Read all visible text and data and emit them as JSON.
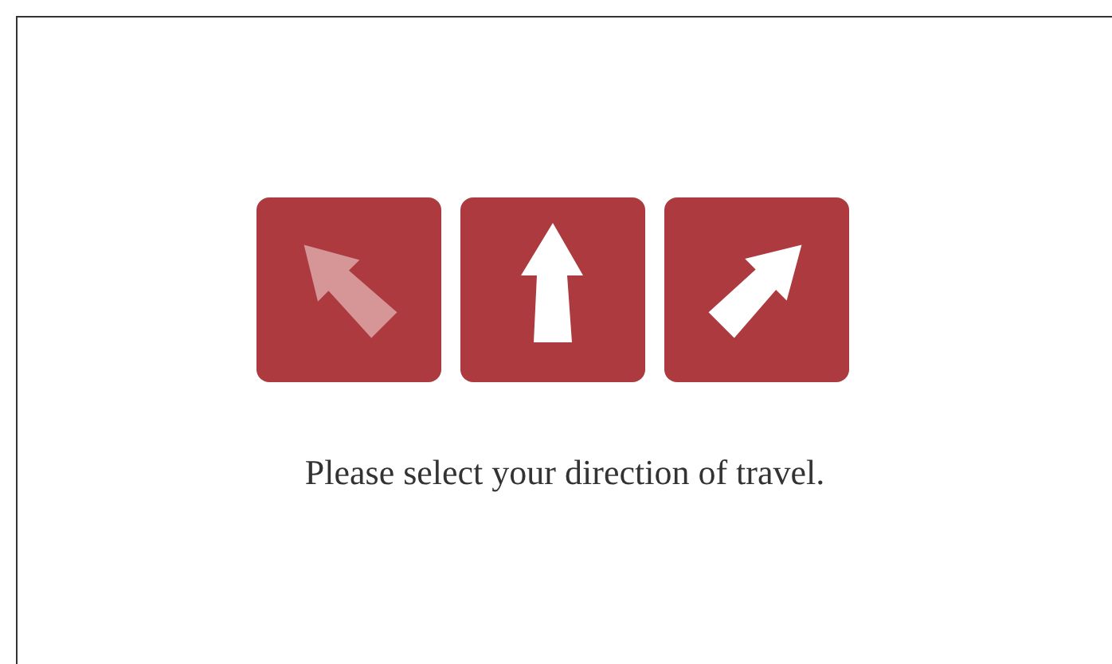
{
  "directions": [
    {
      "kind": "up-left",
      "disabled": true
    },
    {
      "kind": "up",
      "disabled": false
    },
    {
      "kind": "up-right",
      "disabled": false
    }
  ],
  "prompt": "Please select your direction of travel."
}
